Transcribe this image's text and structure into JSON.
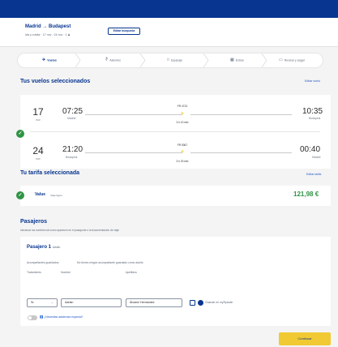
{
  "header": {
    "route": "Madrid → Budapest",
    "route_sub": "Ida y vuelta · 17 nov - 24 nov · 1",
    "edit_button": "Editar búsqueda"
  },
  "steps": [
    {
      "label": "Vuelos",
      "icon": "plane-icon",
      "active": true
    },
    {
      "label": "Asientos",
      "icon": "seat-icon",
      "active": false
    },
    {
      "label": "Equipaje",
      "icon": "bag-icon",
      "active": false
    },
    {
      "label": "Extras",
      "icon": "extras-icon",
      "active": false
    },
    {
      "label": "Revisar y pagar",
      "icon": "card-icon",
      "active": false
    }
  ],
  "flights_section": {
    "title": "Tus vuelos seleccionados",
    "edit_link": "Editar vuelo",
    "flights": [
      {
        "day": "17",
        "month": "nov",
        "dep_time": "07:25",
        "dep_city": "Madrid",
        "flight_no": "FR 4713",
        "duration": "3 h 10 min",
        "arr_time": "10:35",
        "arr_city": "Budapest"
      },
      {
        "day": "24",
        "month": "nov",
        "dep_time": "21:20",
        "dep_city": "Budapest",
        "flight_no": "FR 5367",
        "duration": "3 h 20 min",
        "arr_time": "00:40",
        "arr_city": "Madrid"
      }
    ]
  },
  "fare_section": {
    "title": "Tu tarifa seleccionada",
    "edit_link": "Editar tarifa",
    "fare_name": "Value",
    "fare_sub": "Viaje ligero",
    "price": "121,98 €"
  },
  "passengers": {
    "title": "Pasajeros",
    "subtitle": "Introduce los nombres tal como aparecen en el pasaporte o la documentación de viaje",
    "passenger_label": "Pasajero 1",
    "passenger_type": "Adulto",
    "companions_label": "Acompañantes guardados",
    "companions_note": "No tienes ningún acompañante guardado como adulto",
    "title_label": "Tratamiento",
    "title_value": "Sr.",
    "name_label": "Nombre",
    "name_value": "Adrián",
    "surname_label": "Apellidos",
    "surname_value": "Álvarez Hernández",
    "save_label": "Guardar en myRyanair",
    "assistance_label": "¿Necesitas asistencia especial?"
  },
  "continue_button": "Continuar",
  "colors": {
    "brand": "#073590",
    "accent": "#f1c933",
    "success": "#2f9444"
  }
}
